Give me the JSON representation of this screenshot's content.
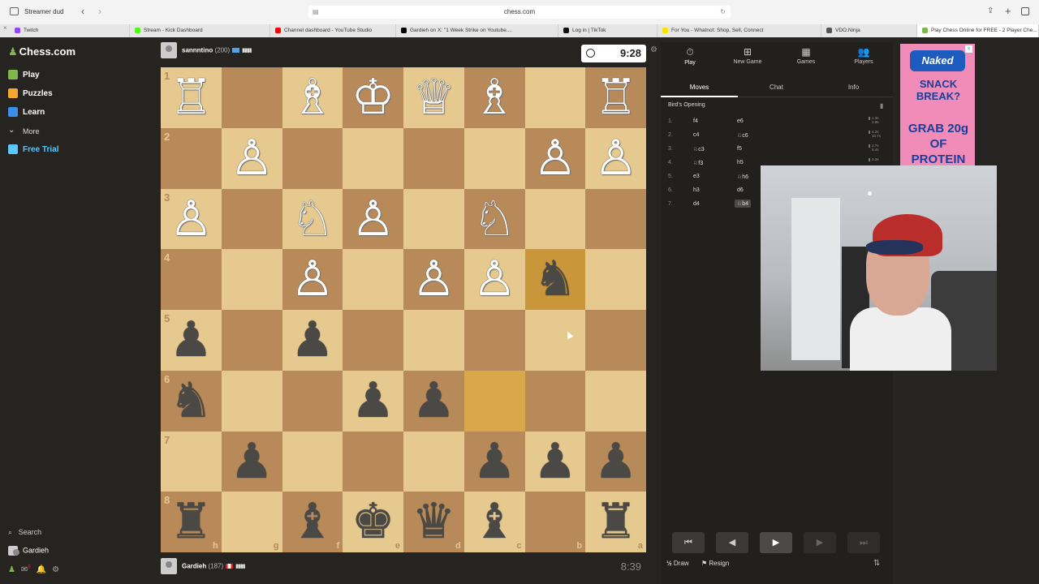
{
  "browser": {
    "profile": "Streamer dud",
    "url": "chess.com",
    "tabs": [
      {
        "label": "Twitch",
        "color": "#9146ff",
        "active": false
      },
      {
        "label": "Stream - Kick Dashboard",
        "color": "#53fc18",
        "active": false
      },
      {
        "label": "Channel dashboard - YouTube Studio",
        "color": "#ff0000",
        "active": false
      },
      {
        "label": "Gardieh on X: \"1 Week Strike on Youtube....",
        "color": "#000000",
        "active": false
      },
      {
        "label": "Log in | TikTok",
        "color": "#111111",
        "active": false
      },
      {
        "label": "For You - Whatnot: Shop, Sell, Connect",
        "color": "#ffe100",
        "active": false
      },
      {
        "label": "VDO.Ninja",
        "color": "#555555",
        "active": false
      },
      {
        "label": "Play Chess Online for FREE - 2 Player Che...",
        "color": "#81b64c",
        "active": true
      }
    ]
  },
  "sidebar": {
    "logo": "Chess.com",
    "items": [
      {
        "label": "Play",
        "color": "#81b64c"
      },
      {
        "label": "Puzzles",
        "color": "#f7a634"
      },
      {
        "label": "Learn",
        "color": "#3a8fe8"
      },
      {
        "label": "More",
        "color": ""
      },
      {
        "label": "Free Trial",
        "color": "#5cc6ff"
      }
    ],
    "search_label": "Search",
    "user_label": "Gardieh",
    "notification_count": "3"
  },
  "top_player": {
    "name": "sannntino",
    "rating": "(200)",
    "clock": "9:28"
  },
  "bottom_player": {
    "name": "Gardieh",
    "rating": "(187)",
    "clock": "8:39"
  },
  "board": {
    "orientation": "black",
    "ranks": [
      "1",
      "2",
      "3",
      "4",
      "5",
      "6",
      "7",
      "8"
    ],
    "files": [
      "h",
      "g",
      "f",
      "e",
      "d",
      "c",
      "b",
      "a"
    ],
    "highlight_squares": [
      "b4",
      "c6"
    ],
    "pieces": [
      {
        "sq": "h1",
        "p": "♖",
        "c": "w"
      },
      {
        "sq": "f1",
        "p": "♗",
        "c": "w"
      },
      {
        "sq": "e1",
        "p": "♔",
        "c": "w"
      },
      {
        "sq": "d1",
        "p": "♕",
        "c": "w"
      },
      {
        "sq": "c1",
        "p": "♗",
        "c": "w"
      },
      {
        "sq": "a1",
        "p": "♖",
        "c": "w"
      },
      {
        "sq": "g2",
        "p": "♙",
        "c": "w"
      },
      {
        "sq": "b2",
        "p": "♙",
        "c": "w"
      },
      {
        "sq": "a2",
        "p": "♙",
        "c": "w"
      },
      {
        "sq": "h3",
        "p": "♙",
        "c": "w"
      },
      {
        "sq": "f3",
        "p": "♘",
        "c": "w"
      },
      {
        "sq": "e3",
        "p": "♙",
        "c": "w"
      },
      {
        "sq": "c3",
        "p": "♘",
        "c": "w"
      },
      {
        "sq": "f4",
        "p": "♙",
        "c": "w"
      },
      {
        "sq": "d4",
        "p": "♙",
        "c": "w"
      },
      {
        "sq": "c4",
        "p": "♙",
        "c": "w"
      },
      {
        "sq": "b4",
        "p": "♞",
        "c": "b"
      },
      {
        "sq": "h5",
        "p": "♟",
        "c": "b"
      },
      {
        "sq": "f5",
        "p": "♟",
        "c": "b"
      },
      {
        "sq": "h6",
        "p": "♞",
        "c": "b"
      },
      {
        "sq": "e6",
        "p": "♟",
        "c": "b"
      },
      {
        "sq": "d6",
        "p": "♟",
        "c": "b"
      },
      {
        "sq": "g7",
        "p": "♟",
        "c": "b"
      },
      {
        "sq": "c7",
        "p": "♟",
        "c": "b"
      },
      {
        "sq": "b7",
        "p": "♟",
        "c": "b"
      },
      {
        "sq": "a7",
        "p": "♟",
        "c": "b"
      },
      {
        "sq": "h8",
        "p": "♜",
        "c": "b"
      },
      {
        "sq": "f8",
        "p": "♝",
        "c": "b"
      },
      {
        "sq": "e8",
        "p": "♚",
        "c": "b"
      },
      {
        "sq": "d8",
        "p": "♛",
        "c": "b"
      },
      {
        "sq": "c8",
        "p": "♝",
        "c": "b"
      },
      {
        "sq": "a8",
        "p": "♜",
        "c": "b"
      }
    ]
  },
  "panel": {
    "top_tabs": [
      {
        "label": "Play",
        "icon": "⏱"
      },
      {
        "label": "New Game",
        "icon": "⊞"
      },
      {
        "label": "Games",
        "icon": "▦"
      },
      {
        "label": "Players",
        "icon": "👥"
      }
    ],
    "sub_tabs": [
      "Moves",
      "Chat",
      "Info"
    ],
    "opening": "Bird's Opening",
    "moves": [
      {
        "n": "1.",
        "w": "f4",
        "b": "e6",
        "t": [
          "1.3s",
          "2.8s"
        ]
      },
      {
        "n": "2.",
        "w": "c4",
        "b": "♘c6",
        "t": [
          "4.2s",
          "10.7s"
        ]
      },
      {
        "n": "3.",
        "w": "♘c3",
        "b": "f5",
        "t": [
          "2.7s",
          "5.4s"
        ]
      },
      {
        "n": "4.",
        "w": "♘f3",
        "b": "h5",
        "t": [
          "",
          "3.3s"
        ]
      },
      {
        "n": "5.",
        "w": "e3",
        "b": "♘h6",
        "t": [
          "",
          ""
        ]
      },
      {
        "n": "6.",
        "w": "h3",
        "b": "d6",
        "t": [
          "",
          ""
        ]
      },
      {
        "n": "7.",
        "w": "d4",
        "b": "♘b4",
        "t": [
          "",
          ""
        ]
      }
    ],
    "controls": [
      "⏮",
      "◀",
      "▶",
      "▶",
      "⏭"
    ],
    "draw_label": "Draw",
    "resign_label": "Resign"
  },
  "ad": {
    "brand": "Naked",
    "line1": "SNACK BREAK?",
    "line2": "GRAB 20g OF PROTEIN"
  }
}
